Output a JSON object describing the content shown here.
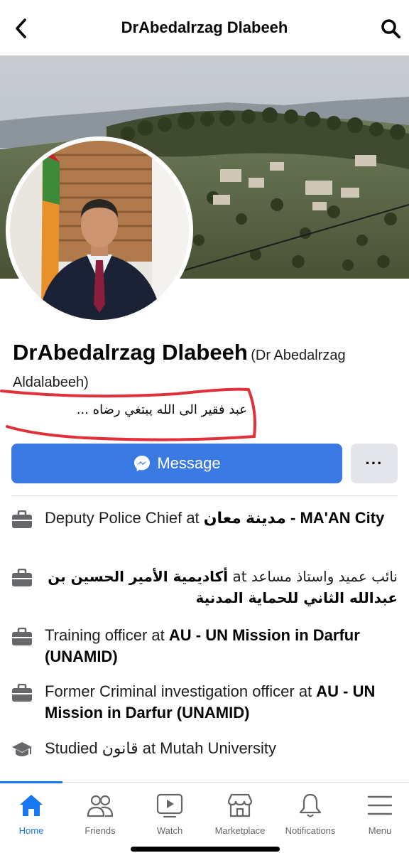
{
  "header": {
    "title": "DrAbedalrzag Dlabeeh",
    "back_icon": "chevron-left-icon",
    "search_icon": "search-icon"
  },
  "profile": {
    "name": "DrAbedalrzag Dlabeeh",
    "alternate_name": "(Dr Abedalrzag Aldalabeeh)",
    "bio": "عبد فقير الى الله يبتغي رضاه ..."
  },
  "actions": {
    "message_label": "Message",
    "more_label": "···"
  },
  "intro": [
    {
      "icon": "briefcase-icon",
      "prefix": "Deputy Police Chief at ",
      "bold": "مدينة معان - MA'AN City",
      "rtl": false
    },
    {
      "icon": "briefcase-icon",
      "prefix": "نائب عميد واستاذ مساعد at ",
      "bold": "أكاديمية الأمير الحسين بن عبدالله الثاني للحماية المدنية",
      "rtl": true
    },
    {
      "icon": "briefcase-icon",
      "prefix": "Training officer at ",
      "bold": "AU - UN Mission in Darfur (UNAMID)",
      "rtl": false
    },
    {
      "icon": "briefcase-icon",
      "prefix": "Former Criminal investigation officer at ",
      "bold": "AU - UN Mission in Darfur (UNAMID)",
      "rtl": false
    },
    {
      "icon": "graduation-cap-icon",
      "prefix": "Studied قانون at Mutah University",
      "bold": "",
      "rtl": false
    }
  ],
  "tabs": [
    {
      "label": "Home",
      "icon": "home-icon",
      "active": true
    },
    {
      "label": "Friends",
      "icon": "friends-icon",
      "active": false
    },
    {
      "label": "Watch",
      "icon": "watch-icon",
      "active": false
    },
    {
      "label": "Marketplace",
      "icon": "marketplace-icon",
      "active": false
    },
    {
      "label": "Notifications",
      "icon": "bell-icon",
      "active": false
    },
    {
      "label": "Menu",
      "icon": "menu-icon",
      "active": false
    }
  ],
  "colors": {
    "accent": "#1877f2",
    "message_button": "#3b7ae3",
    "annotation": "#e0313a"
  }
}
